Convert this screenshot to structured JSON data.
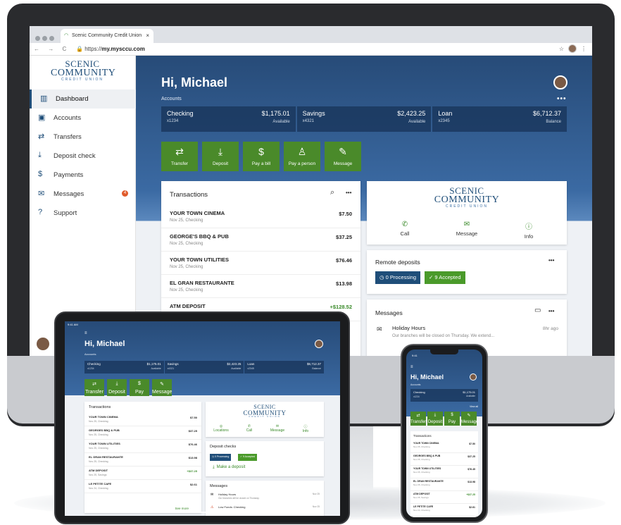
{
  "browser": {
    "tab_title": "Scenic Community Credit Union",
    "tab_close": "×",
    "url_prefix": "https://",
    "url_domain": "my.mysccu.com",
    "nav_glyphs": "← → C"
  },
  "logo": {
    "line1": "SCENIC",
    "line2": "COMMUNITY",
    "line3": "CREDIT UNION"
  },
  "sidebar": {
    "items": [
      {
        "label": "Dashboard",
        "icon": "dashboard-icon",
        "glyph": "▥"
      },
      {
        "label": "Accounts",
        "icon": "wallet-icon",
        "glyph": "▣"
      },
      {
        "label": "Transfers",
        "icon": "transfer-icon",
        "glyph": "⇄"
      },
      {
        "label": "Deposit check",
        "icon": "deposit-icon",
        "glyph": "⤓"
      },
      {
        "label": "Payments",
        "icon": "payment-icon",
        "glyph": "$"
      },
      {
        "label": "Messages",
        "icon": "mail-icon",
        "glyph": "✉",
        "badge": "4"
      },
      {
        "label": "Support",
        "icon": "help-icon",
        "glyph": "?"
      }
    ]
  },
  "main": {
    "greeting": "Hi, Michael",
    "accounts_label": "Accounts",
    "more": "•••",
    "accounts": [
      {
        "name": "Checking",
        "sub": "x1234",
        "amount": "$1,175.01",
        "type": "Available"
      },
      {
        "name": "Savings",
        "sub": "x4321",
        "amount": "$2,423.25",
        "type": "Available"
      },
      {
        "name": "Loan",
        "sub": "x2345",
        "amount": "$6,712.37",
        "type": "Balance"
      }
    ],
    "actions": [
      {
        "label": "Transfer",
        "glyph": "⇄"
      },
      {
        "label": "Deposit",
        "glyph": "⤓"
      },
      {
        "label": "Pay a bill",
        "glyph": "$"
      },
      {
        "label": "Pay a person",
        "glyph": "♙"
      },
      {
        "label": "Message",
        "glyph": "✎"
      }
    ],
    "transactions_title": "Transactions",
    "transactions": [
      {
        "name": "YOUR TOWN CINEMA",
        "date": "Nov 25, Checking",
        "amount": "$7.50"
      },
      {
        "name": "GEORGE'S BBQ & PUB",
        "date": "Nov 25, Checking",
        "amount": "$37.25"
      },
      {
        "name": "YOUR TOWN UTILITIES",
        "date": "Nov 25, Checking",
        "amount": "$76.46"
      },
      {
        "name": "EL GRAN RESTAURANTE",
        "date": "Nov 25, Checking",
        "amount": "$13.98"
      },
      {
        "name": "ATM DEPOSIT",
        "date": "",
        "amount": "+$128.52"
      }
    ],
    "brand_actions": [
      {
        "label": "Call",
        "glyph": "✆"
      },
      {
        "label": "Message",
        "glyph": "✉"
      },
      {
        "label": "Info",
        "glyph": "ⓘ"
      }
    ],
    "remote_deposits_title": "Remote deposits",
    "processing": "0 Processing",
    "accepted": "9 Accepted",
    "messages_title": "Messages",
    "messages": [
      {
        "title": "Holiday Hours",
        "preview": "Our branches will be closed on Thursday. We extend...",
        "time": "8hr ago"
      }
    ]
  },
  "tablet": {
    "status_time": "9:41 AM",
    "greeting": "Hi, Michael",
    "accounts_label": "Accounts",
    "accounts": [
      {
        "name": "Checking",
        "sub": "x1234",
        "amount": "$1,175.01",
        "type": "Available"
      },
      {
        "name": "Savings",
        "sub": "x4321",
        "amount": "$2,423.25",
        "type": "Available"
      },
      {
        "name": "Loan",
        "sub": "x2345",
        "amount": "$6,712.37",
        "type": "Balance"
      }
    ],
    "actions": [
      {
        "label": "Transfer",
        "glyph": "⇄"
      },
      {
        "label": "Deposit",
        "glyph": "⤓"
      },
      {
        "label": "Pay",
        "glyph": "$"
      },
      {
        "label": "Message",
        "glyph": "✎"
      }
    ],
    "transactions_title": "Transactions",
    "transactions": [
      {
        "name": "YOUR TOWN CINEMA",
        "date": "Nov 25, Checking",
        "amount": "$7.50"
      },
      {
        "name": "GEORGES BBQ & PUB",
        "date": "Nov 25, Checking",
        "amount": "$37.25"
      },
      {
        "name": "YOUR TOWN UTILITIES",
        "date": "Nov 25, Checking",
        "amount": "$76.46"
      },
      {
        "name": "EL GRAN RESTAURANTE",
        "date": "Nov 25, Checking",
        "amount": "$13.98"
      },
      {
        "name": "ATM DEPOSIT",
        "date": "Nov 25, Savings",
        "amount": "+$37.25"
      },
      {
        "name": "LE PETITE CAFE",
        "date": "Nov 24, Checking",
        "amount": "$2.61"
      }
    ],
    "see_more": "See more",
    "brand_actions": [
      "Locations",
      "Call",
      "Message",
      "Info"
    ],
    "deposit_checks_title": "Deposit checks",
    "processing": "0 Processing",
    "accepted": "9 Accepted",
    "make_deposit": "Make a deposit",
    "messages_title": "Messages",
    "messages": [
      {
        "title": "Holiday Hours",
        "preview": "Our branches will be closed on Thursday.",
        "time": "Nov 25"
      },
      {
        "title": "Low Funds: Checking",
        "preview": "",
        "time": "Nov 25"
      }
    ]
  },
  "phone": {
    "status_time": "9:41",
    "greeting": "Hi, Michael",
    "accounts_label": "Accounts",
    "account": {
      "name": "Checking",
      "sub": "x1234",
      "amount": "$1,175.01",
      "type": "Available"
    },
    "view_all": "View all",
    "actions": [
      {
        "label": "Transfer",
        "glyph": "⇄"
      },
      {
        "label": "Deposit",
        "glyph": "⤓"
      },
      {
        "label": "Pay",
        "glyph": "$"
      },
      {
        "label": "Message",
        "glyph": "✎"
      }
    ],
    "transactions_title": "Transactions",
    "transactions": [
      {
        "name": "YOUR TOWN CINEMA",
        "date": "Nov 25, Checking",
        "amount": "$7.50"
      },
      {
        "name": "GEORGES BBQ & PUB",
        "date": "Nov 25, Checking",
        "amount": "$37.25"
      },
      {
        "name": "YOUR TOWN UTILITIES",
        "date": "Nov 25, Checking",
        "amount": "$76.45"
      },
      {
        "name": "EL GRAN RESTAURANTE",
        "date": "Nov 25, Checking",
        "amount": "$13.98"
      },
      {
        "name": "ATM DEPOSIT",
        "date": "Nov 25, Savings",
        "amount": "+$37.25"
      },
      {
        "name": "LE PETITE CAFE",
        "date": "Nov 24, Checking",
        "amount": "$2.61"
      }
    ]
  },
  "colors": {
    "brand_blue": "#1f4e79",
    "action_green": "#4a8a2a",
    "processing_blue": "#1f4e79",
    "accepted_green": "#4a9a2a",
    "badge": "#e05a2b"
  }
}
